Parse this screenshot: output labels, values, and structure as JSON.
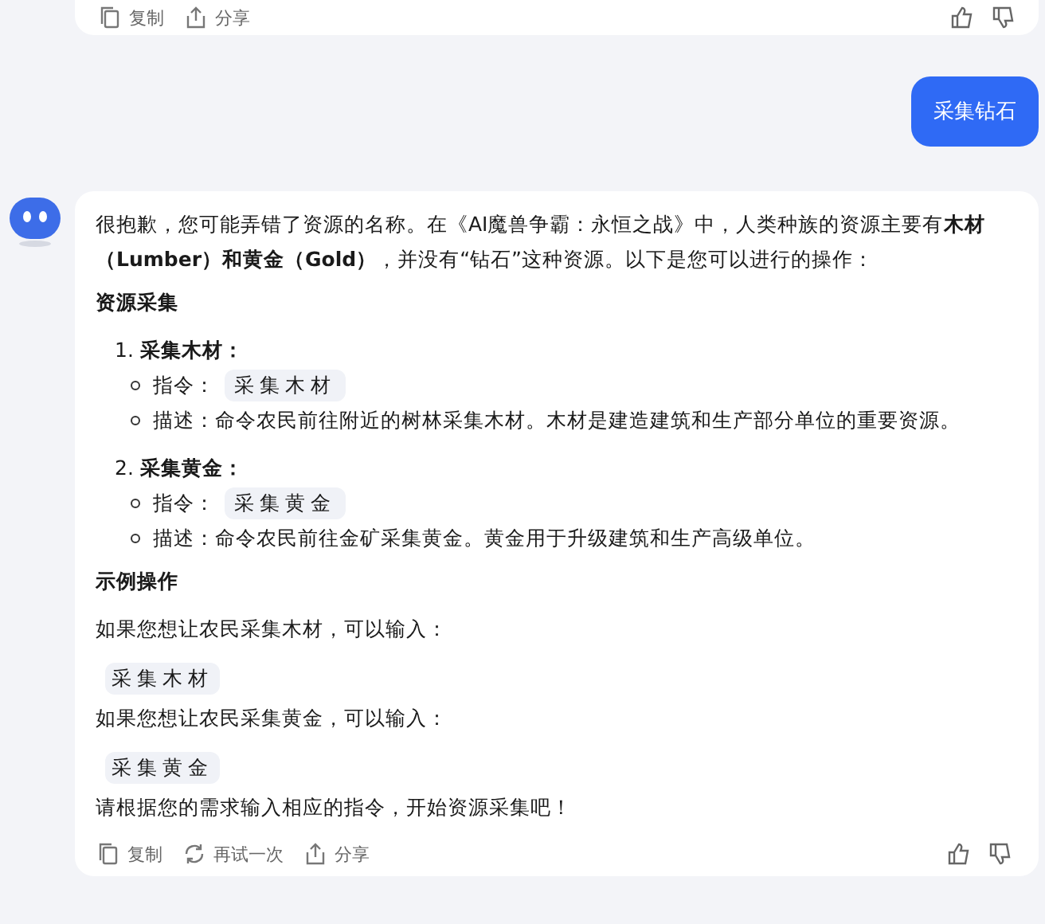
{
  "previous_message": {
    "actions": [
      {
        "kind": "copy",
        "label": "复制"
      },
      {
        "kind": "share",
        "label": "分享"
      }
    ]
  },
  "user_message": {
    "text": "采集钻石"
  },
  "reply": {
    "blocks": [
      {
        "kind": "paragraph",
        "text": "很抱歉，您可能弄错了资源的名称。在《AI魔兽争霸：永恒之战》中，人类种族的资源主要有**木材（Lumber）和黄金（Gold）**，并没有“钻石”这种资源。以下是您可以进行的操作："
      },
      {
        "kind": "heading",
        "text": "资源采集"
      },
      {
        "kind": "steps",
        "items": [
          {
            "number": "1.",
            "title": "采集木材：",
            "bullets": [
              {
                "kind": "command",
                "label": "指令：",
                "code": "采集木材"
              },
              {
                "kind": "text",
                "text": "描述：命令农民前往附近的树林采集木材。木材是建造建筑和生产部分单位的重要资源。"
              }
            ]
          },
          {
            "number": "2.",
            "title": "采集黄金：",
            "bullets": [
              {
                "kind": "command",
                "label": "指令：",
                "code": "采集黄金"
              },
              {
                "kind": "text",
                "text": "描述：命令农民前往金矿采集黄金。黄金用于升级建筑和生产高级单位。"
              }
            ]
          }
        ]
      },
      {
        "kind": "heading",
        "text": "示例操作"
      },
      {
        "kind": "paragraph",
        "text": "如果您想让农民采集木材，可以输入："
      },
      {
        "kind": "code",
        "text": "采集木材"
      },
      {
        "kind": "paragraph",
        "text": "如果您想让农民采集黄金，可以输入："
      },
      {
        "kind": "code",
        "text": "采集黄金"
      },
      {
        "kind": "paragraph",
        "text": "请根据您的需求输入相应的指令，开始资源采集吧！"
      }
    ],
    "actions": [
      {
        "kind": "copy",
        "label": "复制"
      },
      {
        "kind": "retry",
        "label": "再试一次"
      },
      {
        "kind": "share",
        "label": "分享"
      }
    ]
  }
}
